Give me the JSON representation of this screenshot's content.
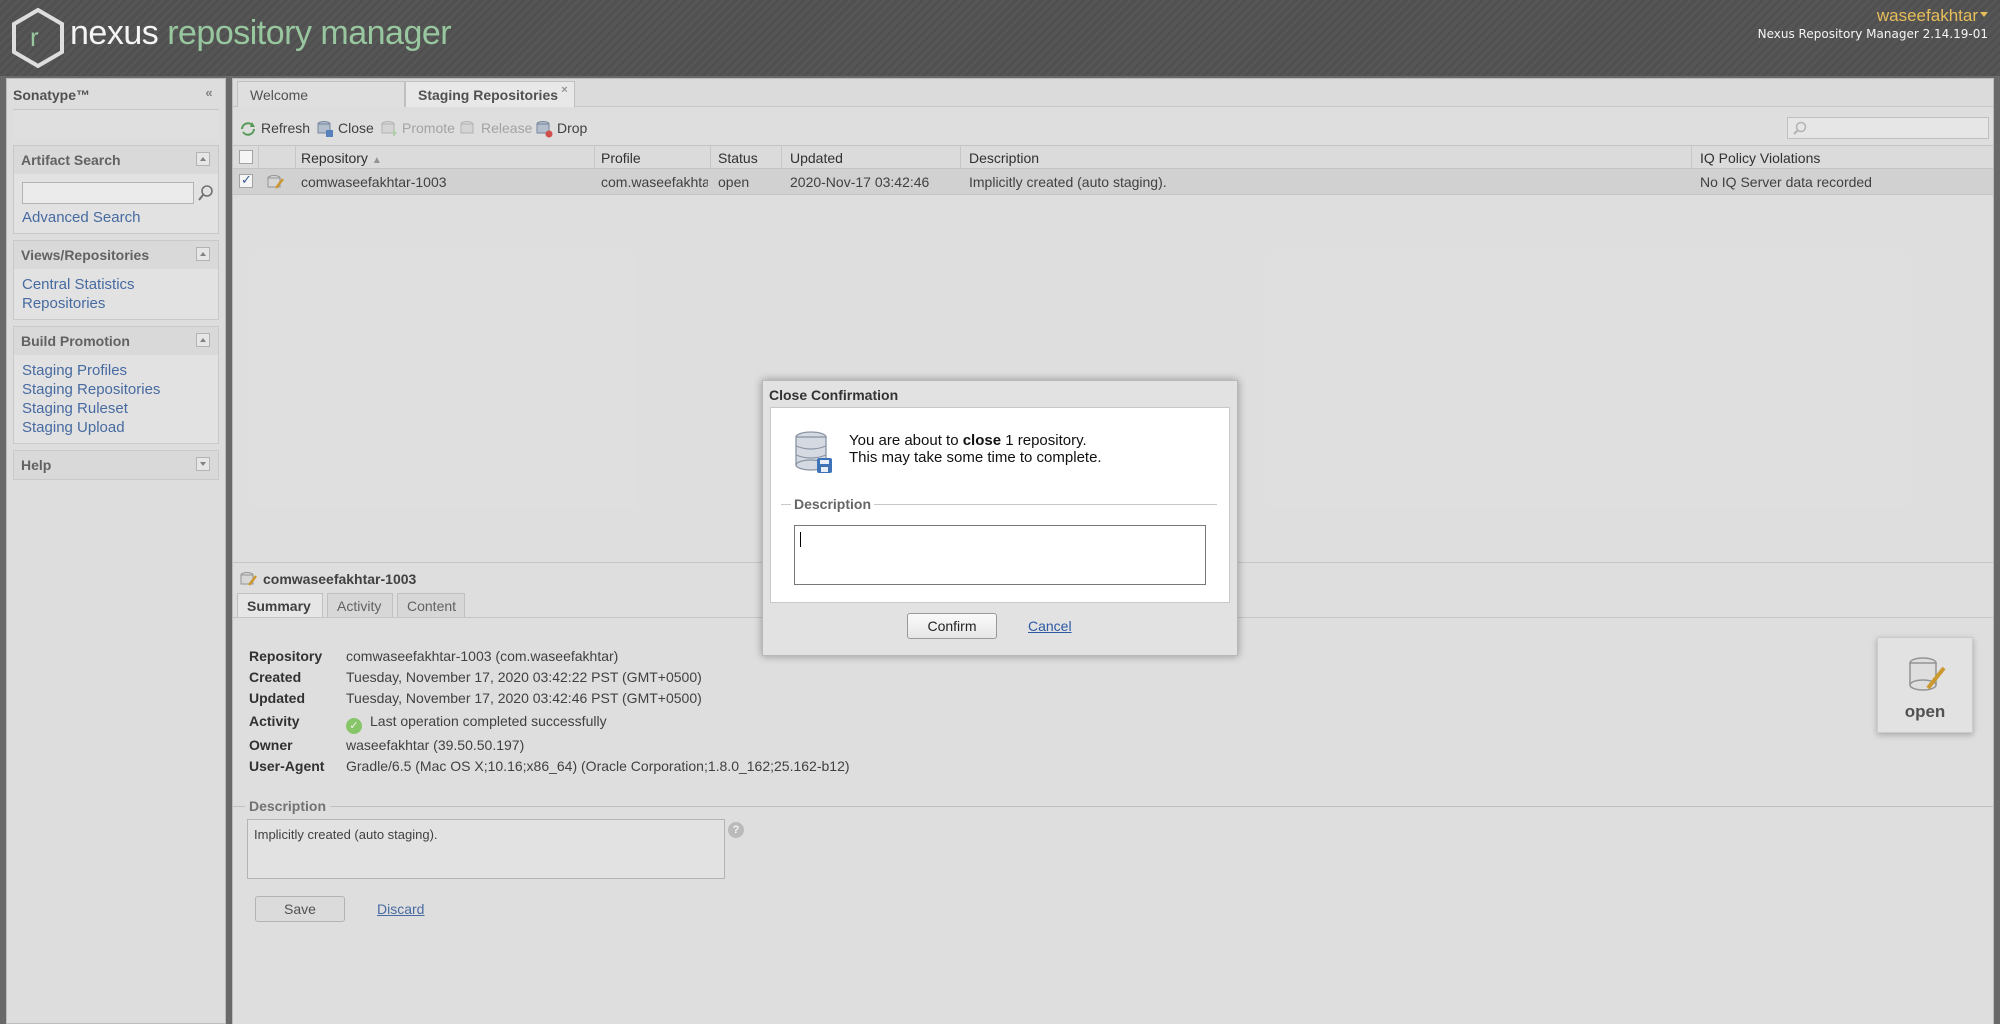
{
  "header": {
    "logo_word1": "nexus",
    "logo_word2": "repository manager",
    "user": "waseefakhtar",
    "version": "Nexus Repository Manager 2.14.19-01"
  },
  "sidebar": {
    "title": "Sonatype™",
    "panels": [
      {
        "title": "Artifact Search",
        "links": [
          "Advanced Search"
        ]
      },
      {
        "title": "Views/Repositories",
        "links": [
          "Central Statistics",
          "Repositories"
        ]
      },
      {
        "title": "Build Promotion",
        "links": [
          "Staging Profiles",
          "Staging Repositories",
          "Staging Ruleset",
          "Staging Upload"
        ]
      },
      {
        "title": "Help",
        "links": []
      }
    ]
  },
  "tabs": [
    {
      "label": "Welcome"
    },
    {
      "label": "Staging Repositories"
    }
  ],
  "toolbar": {
    "refresh": "Refresh",
    "close": "Close",
    "promote": "Promote",
    "release": "Release",
    "drop": "Drop"
  },
  "grid": {
    "columns": [
      "Repository",
      "Profile",
      "Status",
      "Updated",
      "Description",
      "IQ Policy Violations"
    ],
    "rows": [
      {
        "repository": "comwaseefakhtar-1003",
        "profile": "com.waseefakhtar",
        "status": "open",
        "updated": "2020-Nov-17 03:42:46",
        "description": "Implicitly created (auto staging).",
        "iq": "No IQ Server data recorded",
        "checked": true
      }
    ]
  },
  "detail": {
    "title": "comwaseefakhtar-1003",
    "tabs": [
      "Summary",
      "Activity",
      "Content"
    ],
    "fields": [
      {
        "key": "Repository",
        "value": "comwaseefakhtar-1003 (com.waseefakhtar)"
      },
      {
        "key": "Created",
        "value": "Tuesday, November 17, 2020 03:42:22 PST (GMT+0500)"
      },
      {
        "key": "Updated",
        "value": "Tuesday, November 17, 2020 03:42:46 PST (GMT+0500)"
      },
      {
        "key": "Activity",
        "value": "Last operation completed successfully"
      },
      {
        "key": "Owner",
        "value": "waseefakhtar (39.50.50.197)"
      },
      {
        "key": "User-Agent",
        "value": "Gradle/6.5 (Mac OS X;10.16;x86_64) (Oracle Corporation;1.8.0_162;25.162-b12)"
      }
    ],
    "description_label": "Description",
    "description_value": "Implicitly created (auto staging).",
    "save": "Save",
    "discard": "Discard",
    "status_card": "open"
  },
  "dialog": {
    "title": "Close Confirmation",
    "msg_pre": "You are about to ",
    "msg_bold": "close",
    "msg_post": " 1 repository.",
    "msg_line2": "This may take some time to complete.",
    "description_label": "Description",
    "description_value": "",
    "confirm": "Confirm",
    "cancel": "Cancel"
  },
  "colors": {
    "accent_user": "#f2c65e",
    "logo_green": "#9fd0a6",
    "link_blue": "#4a6fa8"
  }
}
